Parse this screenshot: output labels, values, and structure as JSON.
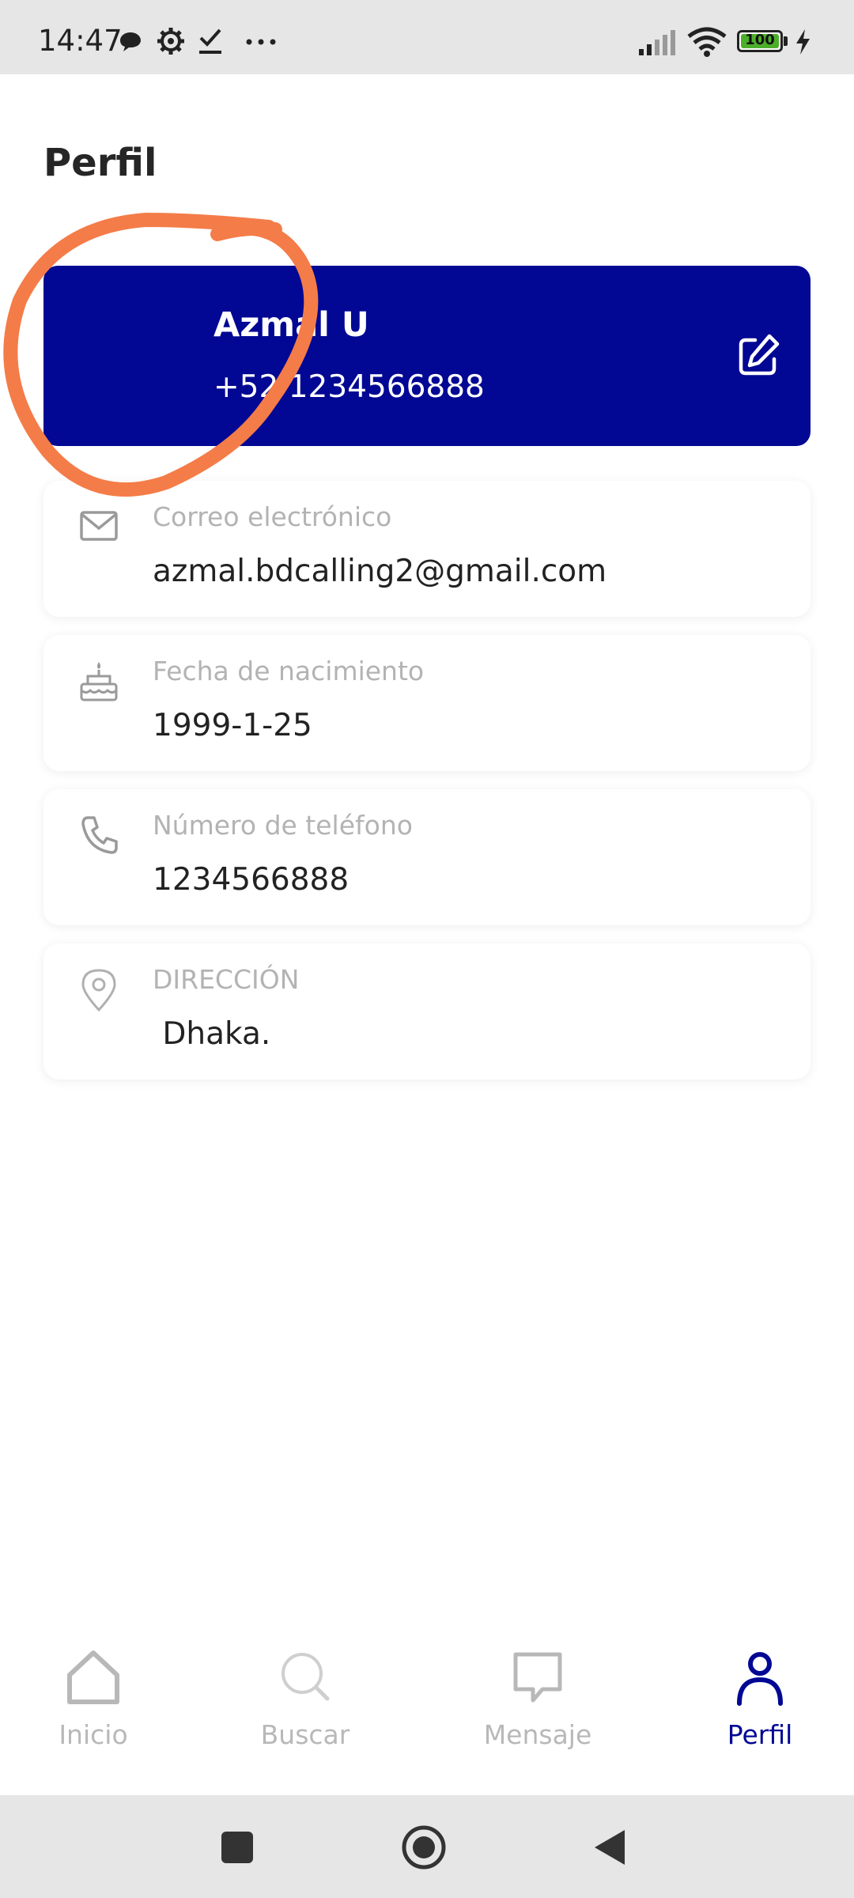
{
  "status_bar": {
    "time": "14:47",
    "icons": [
      "chat-bubble-icon",
      "gear-icon",
      "check-icon",
      "more-dots-icon"
    ],
    "right_icons": [
      "signal-icon",
      "wifi-icon",
      "battery-icon",
      "charging-icon"
    ],
    "battery_level": "100",
    "battery_fill_fraction": 1.0
  },
  "page": {
    "title": "Perfil"
  },
  "profile": {
    "name": "Azmal U",
    "phone": "+52 1234566888",
    "card_color": "#020893"
  },
  "info": [
    {
      "icon": "mail-icon",
      "label": "Correo electrónico",
      "value": "azmal.bdcalling2@gmail.com"
    },
    {
      "icon": "cake-icon",
      "label": "Fecha de nacimiento",
      "value": "1999-1-25"
    },
    {
      "icon": "phone-icon",
      "label": "Número de teléfono",
      "value": "1234566888"
    },
    {
      "icon": "location-pin-icon",
      "label": "DIRECCIÓN",
      "value": " Dhaka."
    }
  ],
  "bottom_nav": {
    "items": [
      {
        "icon": "home-icon",
        "label": "Inicio",
        "active": false
      },
      {
        "icon": "search-icon",
        "label": "Buscar",
        "active": false
      },
      {
        "icon": "message-icon",
        "label": "Mensaje",
        "active": false
      },
      {
        "icon": "user-icon",
        "label": "Perfil",
        "active": true
      }
    ],
    "active_color": "#020893",
    "inactive_color": "#b8b8b8"
  },
  "annotation": {
    "color": "#f47c48"
  },
  "system_nav": {
    "buttons": [
      "recents-square-icon",
      "home-circle-icon",
      "back-triangle-icon"
    ]
  }
}
